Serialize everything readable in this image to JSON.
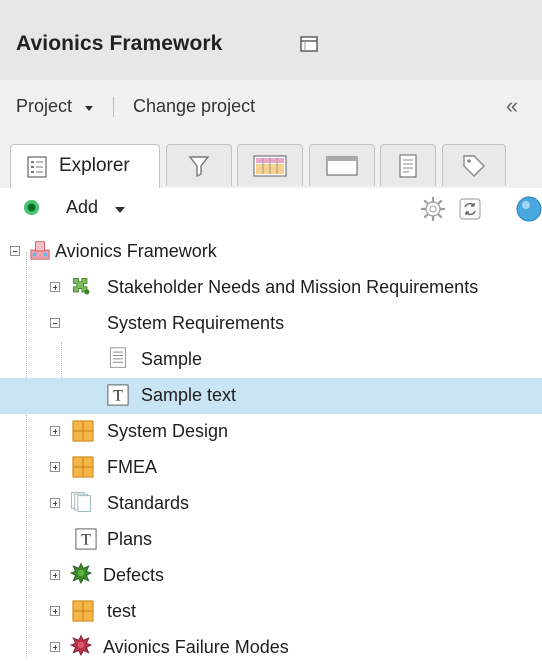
{
  "header": {
    "title": "Avionics Framework",
    "icon": "panel-icon"
  },
  "project_bar": {
    "project_label": "Project",
    "change_project_label": "Change project",
    "collapse_glyph": "«"
  },
  "tabs": [
    {
      "label": "Explorer",
      "icon": "explorer-icon",
      "active": true
    },
    {
      "label": "",
      "icon": "filter-icon",
      "active": false
    },
    {
      "label": "",
      "icon": "grid-icon",
      "active": false
    },
    {
      "label": "",
      "icon": "window-icon",
      "active": false
    },
    {
      "label": "",
      "icon": "document-icon",
      "active": false
    },
    {
      "label": "",
      "icon": "tag-icon",
      "active": false
    }
  ],
  "toolbar": {
    "add_label": "Add",
    "icons": [
      "settings-icon",
      "sync-icon",
      "info-icon"
    ]
  },
  "tree": {
    "items": [
      {
        "label": "Avionics Framework",
        "icon": "project-icon",
        "expander": "minus",
        "level": 0
      },
      {
        "label": "Stakeholder Needs and Mission Requirements",
        "icon": "requirements-icon",
        "expander": "plus",
        "level": 1
      },
      {
        "label": "System Requirements",
        "icon": "",
        "expander": "minus",
        "level": 1
      },
      {
        "label": "Sample",
        "icon": "document-lines-icon",
        "expander": "",
        "level": 2
      },
      {
        "label": "Sample text",
        "icon": "text-icon",
        "expander": "",
        "level": 2,
        "selected": true
      },
      {
        "label": "System Design",
        "icon": "grid-table-icon",
        "expander": "plus",
        "level": 1
      },
      {
        "label": "FMEA",
        "icon": "grid-table-icon",
        "expander": "plus",
        "level": 1
      },
      {
        "label": "Standards",
        "icon": "pages-icon",
        "expander": "plus",
        "level": 1
      },
      {
        "label": "Plans",
        "icon": "text-icon",
        "expander": "",
        "level": 1
      },
      {
        "label": "Defects",
        "icon": "bug-icon",
        "expander": "plus",
        "level": 1
      },
      {
        "label": "test",
        "icon": "grid-table-icon",
        "expander": "plus",
        "level": 1
      },
      {
        "label": "Avionics Failure Modes",
        "icon": "bug-red-icon",
        "expander": "plus",
        "level": 1
      }
    ]
  },
  "colors": {
    "selected_row": "#c9e5f3",
    "add_green": "#1fa34a",
    "grid_orange": "#f2a22c",
    "bug_green": "#3b8a2c",
    "bug_red": "#b8324a"
  }
}
